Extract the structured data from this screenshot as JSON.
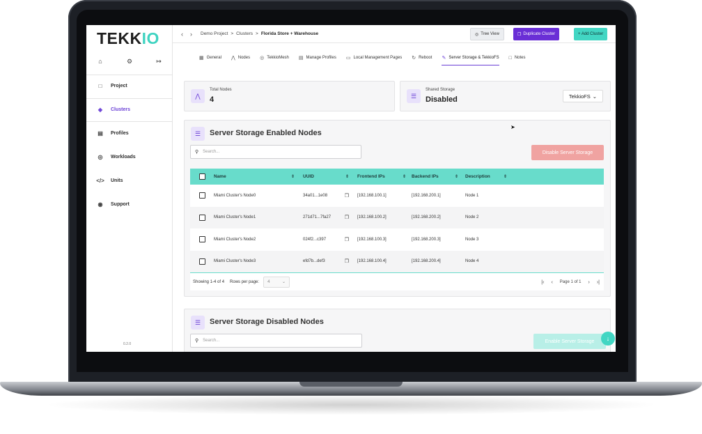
{
  "app": {
    "logo_main": "TEKK",
    "logo_accent": "IO",
    "version": "0.2.0"
  },
  "sidebar": {
    "top_icons": [
      "home-icon",
      "gear-icon",
      "logout-icon"
    ],
    "items": [
      {
        "label": "Project",
        "icon": "folder-icon"
      },
      {
        "label": "Clusters",
        "icon": "cluster-icon",
        "active": true
      },
      {
        "label": "Profiles",
        "icon": "file-icon"
      },
      {
        "label": "Workloads",
        "icon": "workload-icon"
      },
      {
        "label": "Units",
        "icon": "code-icon"
      },
      {
        "label": "Support",
        "icon": "headset-icon"
      }
    ]
  },
  "topbar": {
    "breadcrumb": [
      "Demo Project",
      "Clusters",
      "Florida Store + Warehouse"
    ],
    "tree_view": "Tree View",
    "duplicate": "Duplicate Cluster",
    "add_cluster": "+ Add Cluster"
  },
  "tabs": [
    {
      "label": "General",
      "icon": "grid-icon"
    },
    {
      "label": "Nodes",
      "icon": "nodes-icon"
    },
    {
      "label": "TekkioMesh",
      "icon": "globe-icon"
    },
    {
      "label": "Manage Profiles",
      "icon": "doc-icon"
    },
    {
      "label": "Local Management Pages",
      "icon": "monitor-icon"
    },
    {
      "label": "Reboot",
      "icon": "reboot-icon"
    },
    {
      "label": "Server Storage & TekkioFS",
      "icon": "wand-icon",
      "active": true
    },
    {
      "label": "Notes",
      "icon": "note-icon"
    }
  ],
  "stats": {
    "total_nodes_label": "Total Nodes",
    "total_nodes_value": "4",
    "shared_storage_label": "Shared Storage",
    "shared_storage_value": "Disabled",
    "fs_select": "TekkioFS"
  },
  "enabled_section": {
    "title": "Server Storage Enabled Nodes",
    "search_placeholder": "Search...",
    "disable_button": "Disable Server Storage",
    "columns": [
      "Name",
      "UUID",
      "Frontend IPs",
      "Backend IPs",
      "Description"
    ],
    "rows": [
      {
        "name": "Miami Cluster's Node0",
        "uuid": "34a01...1e08",
        "frontend": "[192.168.100.1]",
        "backend": "[192.168.200.1]",
        "desc": "Node 1"
      },
      {
        "name": "Miami Cluster's Node1",
        "uuid": "271d71...7fa27",
        "frontend": "[192.168.100.2]",
        "backend": "[192.168.200.2]",
        "desc": "Node 2"
      },
      {
        "name": "Miami Cluster's Node2",
        "uuid": "024f2...c397",
        "frontend": "[192.168.100.3]",
        "backend": "[192.168.200.3]",
        "desc": "Node 3"
      },
      {
        "name": "Miami Cluster's Node3",
        "uuid": "efd7b...def3",
        "frontend": "[192.168.100.4]",
        "backend": "[192.168.200.4]",
        "desc": "Node 4"
      }
    ],
    "showing": "Showing 1-4 of 4",
    "rows_per_page_label": "Rows per page:",
    "rows_per_page_value": "4",
    "page_label": "Page 1 of 1"
  },
  "disabled_section": {
    "title": "Server Storage Disabled Nodes",
    "search_placeholder": "Search...",
    "enable_button": "Enable Server Storage"
  }
}
